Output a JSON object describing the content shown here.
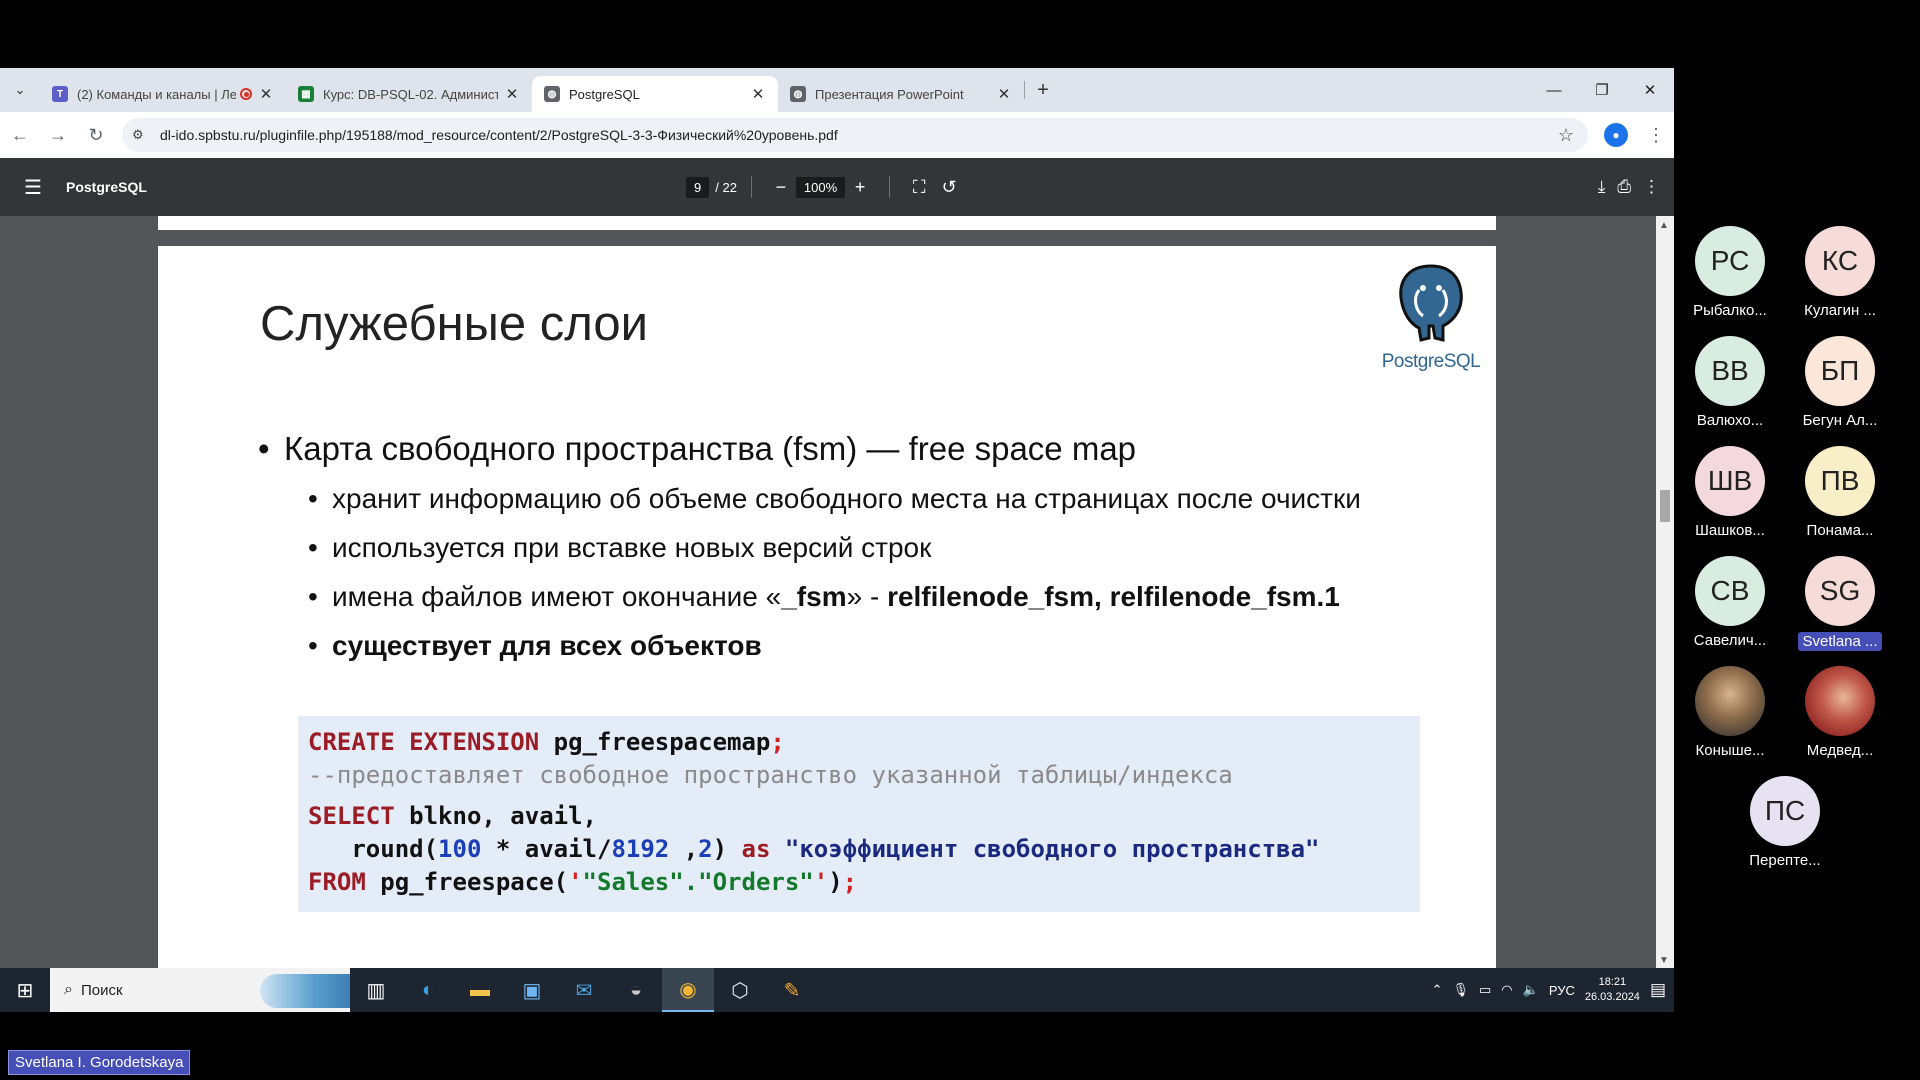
{
  "browser": {
    "tabs": [
      {
        "title": "(2) Команды и каналы | Ле",
        "favicon": "teams-icon",
        "recording": true,
        "active": false
      },
      {
        "title": "Курс: DB-PSQL-02. Администр",
        "favicon": "sheets-icon",
        "active": false
      },
      {
        "title": "PostgreSQL",
        "favicon": "globe-icon",
        "active": true
      },
      {
        "title": "Презентация PowerPoint",
        "favicon": "globe-icon",
        "active": false
      }
    ],
    "url": "dl-ido.spbstu.ru/pluginfile.php/195188/mod_resource/content/2/PostgreSQL-3-3-Физический%20уровень.pdf"
  },
  "pdf_toolbar": {
    "title": "PostgreSQL",
    "current_page": "9",
    "total_pages": "/ 22",
    "zoom": "100%"
  },
  "slide": {
    "title": "Служебные слои",
    "logo_caption": "PostgreSQL",
    "bullet_main": "Карта свободного пространства (fsm) — free space map",
    "sub1": "хранит информацию об объеме свободного места на страницах после очистки",
    "sub2": "используется при вставке новых версий строк",
    "sub3_a": "имена файлов имеют окончание «",
    "sub3_b": "_fsm",
    "sub3_c": "» - ",
    "sub3_d": "relfilenode_fsm, relfilenode_fsm.1",
    "sub4": "существует для всех объектов"
  },
  "code": {
    "l1_kw": "CREATE EXTENSION",
    "l1_rest": " pg_freespacemap",
    "l1_semi": ";",
    "l2": "--предоставляет свободное пространство указанной таблицы/индекса",
    "l3_kw": "SELECT",
    "l3_rest": " blkno, avail,",
    "l4_a": "   round(",
    "l4_n1": "100",
    "l4_b": " * avail/",
    "l4_n2": "8192",
    "l4_c": " ,",
    "l4_n3": "2",
    "l4_d": ") ",
    "l4_as": "as",
    "l4_str": " \"коэффициент свободного пространства\"",
    "l5_kw": "FROM",
    "l5_a": " pg_freespace(",
    "l5_q1": "'",
    "l5_str": "\"Sales\".\"Orders\"",
    "l5_q2": "'",
    "l5_b": ")",
    "l5_semi": ";"
  },
  "taskbar": {
    "search_placeholder": "Поиск",
    "lang": "РУС",
    "time": "18:21",
    "date": "26.03.2024"
  },
  "participants": [
    {
      "initials": "РС",
      "name": "Рыбалко...",
      "color": "#d9ece2"
    },
    {
      "initials": "КС",
      "name": "Кулагин ...",
      "color": "#f6dcd8"
    },
    {
      "initials": "ВВ",
      "name": "Валюхо...",
      "color": "#d9ece2"
    },
    {
      "initials": "БП",
      "name": "Бегун Ал...",
      "color": "#fbe7d9"
    },
    {
      "initials": "ШВ",
      "name": "Шашков...",
      "color": "#f3d9dd"
    },
    {
      "initials": "ПВ",
      "name": "Понама...",
      "color": "#f8efc8"
    },
    {
      "initials": "СВ",
      "name": "Савелич...",
      "color": "#d9ece2"
    },
    {
      "initials": "SG",
      "name": "Svetlana ...",
      "color": "#f6dcd8"
    },
    {
      "initials": "",
      "name": "Коныше...",
      "color": "#6b5a44"
    },
    {
      "initials": "",
      "name": "Медвед...",
      "color": "#a0302a"
    },
    {
      "initials": "ПС",
      "name": "Перепте...",
      "color": "#e6e2f1"
    }
  ],
  "speaker_label": "Svetlana I. Gorodetskaya"
}
